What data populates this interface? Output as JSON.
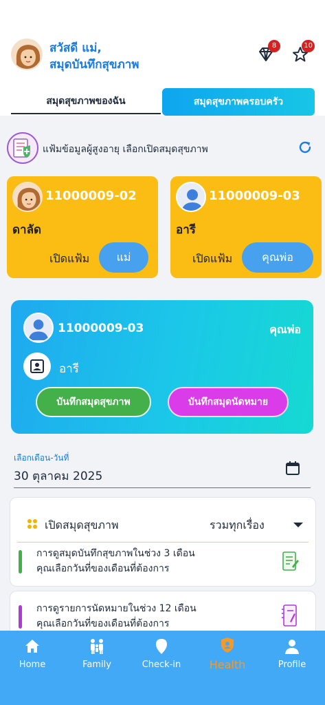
{
  "header": {
    "greeting_line1": "สวัสดี แม่,",
    "greeting_line2": "สมุดบันทึกสุขภาพ",
    "diamond_badge": "8",
    "star_badge": "10"
  },
  "tabs": [
    {
      "label": "สมุดสุขภาพของฉัน"
    },
    {
      "label": "สมุดสุขภาพครอบครัว"
    }
  ],
  "select_section": {
    "text": "แฟ้มข้อมูลผู้สูงอายุ เลือกเปิดสมุดสุขภาพ"
  },
  "elder_cards": [
    {
      "id": "11000009-02",
      "name": "ดาลัด",
      "open_label": "เปิดแฟ้ม",
      "relation": "แม่"
    },
    {
      "id": "11000009-03",
      "name": "อารี",
      "open_label": "เปิดแฟ้ม",
      "relation": "คุณพ่อ"
    }
  ],
  "selected_card": {
    "id": "11000009-03",
    "relation": "คุณพ่อ",
    "name": "อารี",
    "btn_health": "บันทึกสมุดสุขภาพ",
    "btn_appoint": "บันทึกสมุดนัดหมาย"
  },
  "date": {
    "label": "เลือกเดือน-วันที่",
    "value": "30 ตุลาคม 2025"
  },
  "panel": {
    "title": "เปิดสมุดสุขภาพ",
    "filter": "รวมทุกเรื่อง",
    "row1_line1": "การดูสมุดบันทึกสุขภาพในช่วง 3 เดือน",
    "row1_line2": "คุณเลือกวันที่ของเดือนที่ต้องการ",
    "row2_line1": "การดูรายการนัดหมายในช่วง 12 เดือน",
    "row2_line2": "คุณเลือกวันที่ของเดือนที่ต้องการ"
  },
  "nav": [
    {
      "label": "Home",
      "icon": "home-icon"
    },
    {
      "label": "Family",
      "icon": "family-icon"
    },
    {
      "label": "Check-in",
      "icon": "location-pin-icon"
    },
    {
      "label": "Health",
      "icon": "shield-icon"
    },
    {
      "label": "Profile",
      "icon": "person-icon"
    }
  ],
  "colors": {
    "accent_blue": "#1a7be0",
    "card_yellow": "#fbbd14",
    "nav_blue": "#42a9f6",
    "active_orange": "#f39a2a",
    "green": "#43b049",
    "purple": "#d93ce8"
  }
}
